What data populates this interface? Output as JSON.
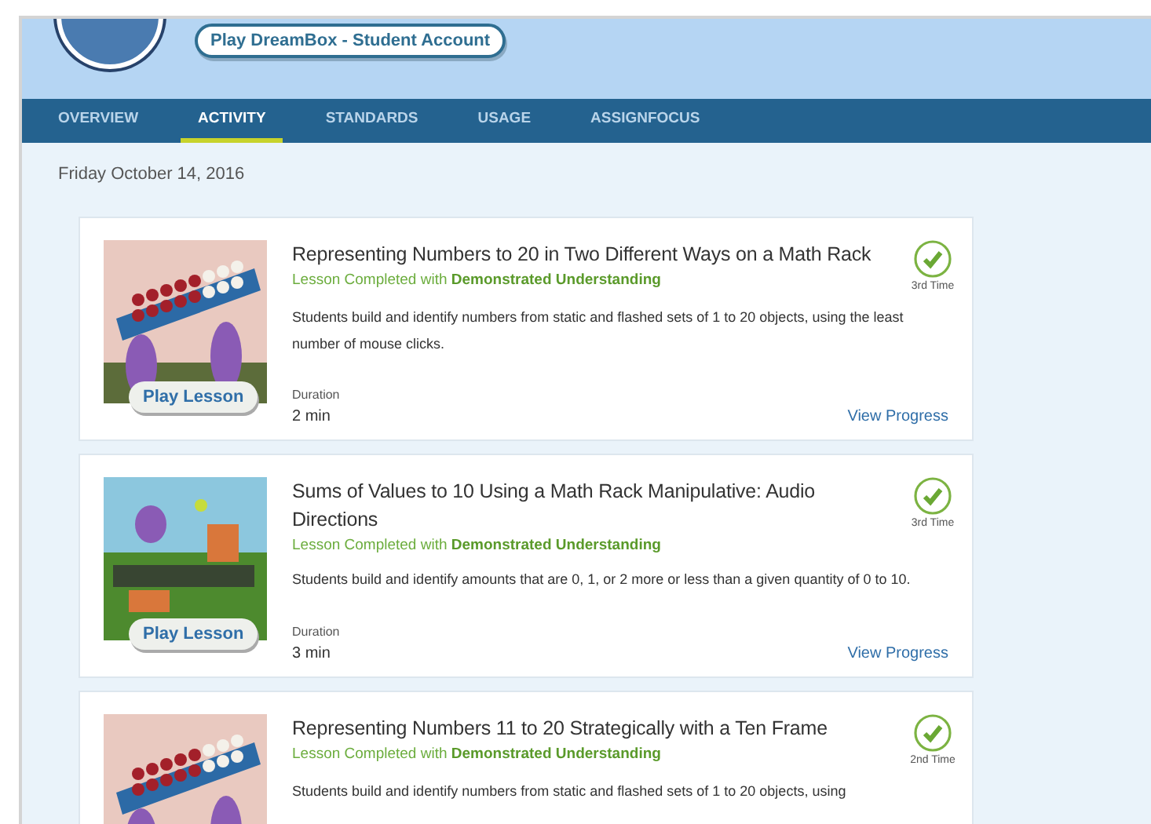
{
  "header": {
    "account_button": "Play DreamBox - Student Account"
  },
  "tabs": [
    {
      "label": "OVERVIEW",
      "selected": false
    },
    {
      "label": "ACTIVITY",
      "selected": true
    },
    {
      "label": "STANDARDS",
      "selected": false
    },
    {
      "label": "USAGE",
      "selected": false
    },
    {
      "label": "ASSIGNFOCUS",
      "selected": false
    }
  ],
  "date": "Friday October 14, 2016",
  "lessons": [
    {
      "kind": "rack",
      "title": "Representing Numbers to 20 in Two Different Ways on a Math Rack",
      "status": "Lesson Completed with **Demonstrated Understanding**",
      "times": "3rd Time",
      "description": "Students build and identify numbers from static and flashed sets of 1 to 20 objects, using the least number of mouse clicks.",
      "play": "Play Lesson",
      "duration_label": "Duration",
      "duration": "2 min",
      "progress_link": "View Progress"
    },
    {
      "kind": "tennis",
      "title": "Sums of Values to 10 Using a Math Rack Manipulative: Audio Directions",
      "status": "Lesson Completed with **Demonstrated Understanding**",
      "times": "3rd Time",
      "description": "Students build and identify amounts that are 0, 1, or 2 more or less than a given quantity of 0 to 10.",
      "play": "Play Lesson",
      "duration_label": "Duration",
      "duration": "3 min",
      "progress_link": "View Progress"
    },
    {
      "kind": "rack",
      "title": "Representing Numbers 11 to 20 Strategically with a Ten Frame",
      "status": "Lesson Completed with **Demonstrated Understanding**",
      "times": "2nd Time",
      "description": "Students build and identify numbers from static and flashed sets of 1 to 20 objects, using"
    }
  ]
}
